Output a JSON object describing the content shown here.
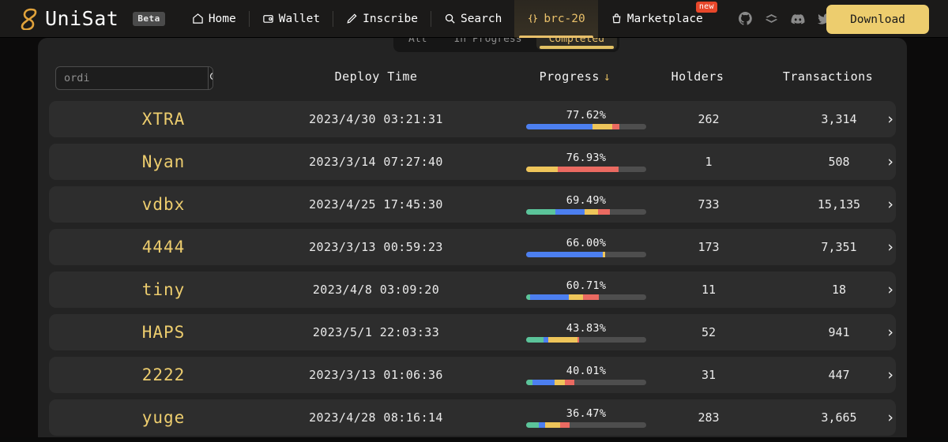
{
  "brand": {
    "name": "UniSat",
    "badge": "Beta",
    "logo_icon": "unisat-logo-icon"
  },
  "nav": {
    "items": [
      {
        "label": "Home",
        "icon": "home-icon",
        "active": false,
        "badge": ""
      },
      {
        "label": "Wallet",
        "icon": "wallet-icon",
        "active": false,
        "badge": ""
      },
      {
        "label": "Inscribe",
        "icon": "pencil-icon",
        "active": false,
        "badge": ""
      },
      {
        "label": "Search",
        "icon": "search-icon",
        "active": false,
        "badge": ""
      },
      {
        "label": "brc-20",
        "icon": "braces-icon",
        "active": true,
        "badge": ""
      },
      {
        "label": "Marketplace",
        "icon": "shopping-bag-icon",
        "active": false,
        "badge": "new"
      }
    ],
    "socials": [
      "github-icon",
      "gitbook-icon",
      "discord-icon",
      "twitter-icon"
    ],
    "download_label": "Download"
  },
  "tabs": [
    {
      "label": "All",
      "selected": false
    },
    {
      "label": "In Progress",
      "selected": false
    },
    {
      "label": "Completed",
      "selected": true
    }
  ],
  "search": {
    "placeholder": "ordi",
    "value": "",
    "icon": "search-icon"
  },
  "table": {
    "columns": {
      "deploy_time": "Deploy Time",
      "progress": "Progress",
      "sort_arrow": "↓",
      "holders": "Holders",
      "transactions": "Transactions"
    },
    "row_arrow": "›",
    "colors": {
      "green": "#5bc49a",
      "blue": "#4c7ff0",
      "yellow": "#eec55a",
      "red": "#ea6a61",
      "track": "#4e4e4e",
      "ticker": "#edcd6e"
    },
    "rows": [
      {
        "ticker": "XTRA",
        "deploy_time": "2023/4/30 03:21:31",
        "progress": "77.62%",
        "segments": [
          {
            "color": "blue",
            "pct": 55
          },
          {
            "color": "yellow",
            "pct": 17
          },
          {
            "color": "red",
            "pct": 5.6
          }
        ],
        "holders": "262",
        "transactions": "3,314"
      },
      {
        "ticker": "Nyan",
        "deploy_time": "2023/3/14 07:27:40",
        "progress": "76.93%",
        "segments": [
          {
            "color": "yellow",
            "pct": 26.5
          },
          {
            "color": "red",
            "pct": 50.4
          }
        ],
        "holders": "1",
        "transactions": "508"
      },
      {
        "ticker": "vdbx",
        "deploy_time": "2023/4/25 17:45:30",
        "progress": "69.49%",
        "segments": [
          {
            "color": "green",
            "pct": 24.5
          },
          {
            "color": "blue",
            "pct": 24.5
          },
          {
            "color": "yellow",
            "pct": 11
          },
          {
            "color": "red",
            "pct": 9.5
          }
        ],
        "holders": "733",
        "transactions": "15,135"
      },
      {
        "ticker": "4444",
        "deploy_time": "2023/3/13 00:59:23",
        "progress": "66.00%",
        "segments": [
          {
            "color": "blue",
            "pct": 63.5
          },
          {
            "color": "yellow",
            "pct": 2.5
          }
        ],
        "holders": "173",
        "transactions": "7,351"
      },
      {
        "ticker": "tiny",
        "deploy_time": "2023/4/8 03:09:20",
        "progress": "60.71%",
        "segments": [
          {
            "color": "green",
            "pct": 3
          },
          {
            "color": "blue",
            "pct": 32.5
          },
          {
            "color": "yellow",
            "pct": 12
          },
          {
            "color": "red",
            "pct": 13.2
          }
        ],
        "holders": "11",
        "transactions": "18"
      },
      {
        "ticker": "HAPS",
        "deploy_time": "2023/5/1 22:03:33",
        "progress": "43.83%",
        "segments": [
          {
            "color": "green",
            "pct": 14.5
          },
          {
            "color": "blue",
            "pct": 4
          },
          {
            "color": "yellow",
            "pct": 24.3
          },
          {
            "color": "red",
            "pct": 1
          }
        ],
        "holders": "52",
        "transactions": "941"
      },
      {
        "ticker": "2222",
        "deploy_time": "2023/3/13 01:06:36",
        "progress": "40.01%",
        "segments": [
          {
            "color": "green",
            "pct": 5.5
          },
          {
            "color": "blue",
            "pct": 18.5
          },
          {
            "color": "yellow",
            "pct": 8
          },
          {
            "color": "red",
            "pct": 8
          }
        ],
        "holders": "31",
        "transactions": "447"
      },
      {
        "ticker": "yuge",
        "deploy_time": "2023/4/28 08:16:14",
        "progress": "36.47%",
        "segments": [
          {
            "color": "green",
            "pct": 10.5
          },
          {
            "color": "blue",
            "pct": 5.5
          },
          {
            "color": "yellow",
            "pct": 12
          },
          {
            "color": "red",
            "pct": 8.5
          }
        ],
        "holders": "283",
        "transactions": "3,665"
      }
    ]
  }
}
